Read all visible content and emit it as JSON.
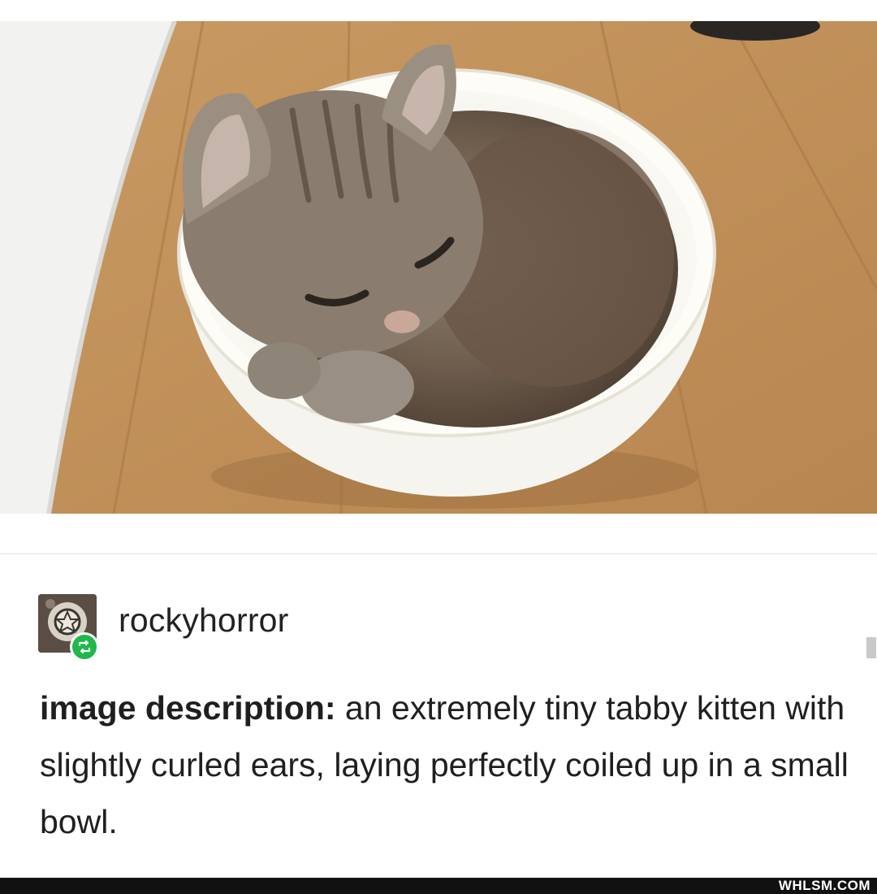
{
  "post": {
    "image_alt": "tiny tabby kitten curled up in a white bowl on a wooden floor",
    "author": {
      "username": "rockyhorror",
      "avatar_icon": "avatar-image",
      "badge_icon": "reblog-icon",
      "badge_color": "#1fb84a"
    },
    "description_lead": "image description:",
    "description_text": " an extremely tiny tabby kitten with slightly curled ears, laying perfectly coiled up in a small bowl."
  },
  "watermark": "WHLSM.COM"
}
